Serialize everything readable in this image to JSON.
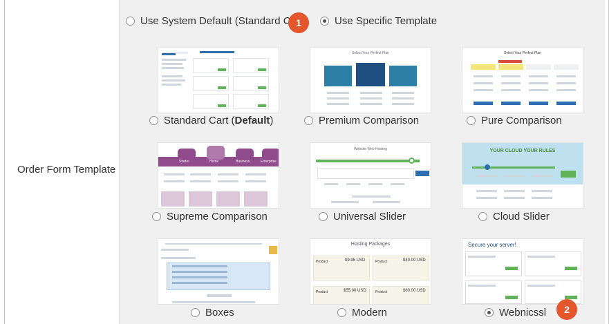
{
  "row_label": "Order Form Template",
  "top_options": [
    {
      "label": "Use System Default (Standard C",
      "selected": false
    },
    {
      "label": "Use Specific Template",
      "selected": true
    }
  ],
  "badges": [
    "1",
    "2"
  ],
  "templates": [
    {
      "name_plain": "Standard Cart (",
      "name_bold": "Default",
      "name_tail": ")",
      "selected": false
    },
    {
      "name": "Premium Comparison",
      "selected": false
    },
    {
      "name": "Pure Comparison",
      "selected": false
    },
    {
      "name": "Supreme Comparison",
      "selected": false
    },
    {
      "name": "Universal Slider",
      "selected": false
    },
    {
      "name": "Cloud Slider",
      "selected": false
    },
    {
      "name": "Boxes",
      "selected": false
    },
    {
      "name": "Modern",
      "selected": false
    },
    {
      "name": "Webnicssl",
      "selected": true
    }
  ],
  "thumb_text": {
    "premium_title": "Select Your Perfect Plan",
    "pure_title": "Select Your Perfect Plan",
    "supreme_tabs": [
      "Starter",
      "Home",
      "Business",
      "Enterprise"
    ],
    "universal_title": "Website Web Hosting",
    "cloud_title": "YOUR CLOUD YOUR RULES",
    "modern_title": "Hosting Packages",
    "webnic_title": "Secure your server!",
    "modern_prices": [
      "$9.95 USD",
      "$40.00 USD",
      "$55.00 USD",
      "$60.00 USD"
    ],
    "modern_product": "Product"
  },
  "colors": {
    "badge": "#e4562b",
    "panel_bg": "#f0f0f0"
  }
}
